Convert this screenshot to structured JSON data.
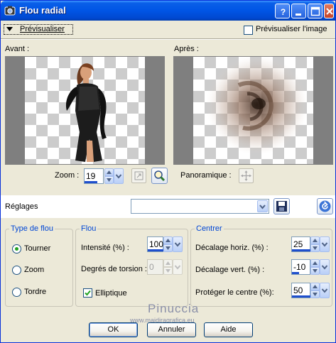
{
  "window": {
    "title": "Flou radial"
  },
  "toolbar": {
    "preview_toggle_label": "Prévisualiser",
    "preview_on_image_label": "Prévisualiser l'image"
  },
  "previews": {
    "before_label": "Avant :",
    "after_label": "Après :"
  },
  "zoom": {
    "label": "Zoom :",
    "value": "19",
    "pan_label": "Panoramique :"
  },
  "presets": {
    "label": "Réglages",
    "value": ""
  },
  "blur_type": {
    "title": "Type de flou",
    "options": [
      "Tourner",
      "Zoom",
      "Tordre"
    ],
    "selected": "Tourner"
  },
  "blur": {
    "title": "Flou",
    "intensity_label": "Intensité (%) :",
    "intensity_value": "100",
    "twist_label": "Degrés de torsion :",
    "twist_value": "0",
    "elliptic_label": "Elliptique",
    "elliptic_checked": true
  },
  "center": {
    "title": "Centrer",
    "h_offset_label": "Décalage horiz. (%) :",
    "h_offset_value": "25",
    "v_offset_label": "Décalage vert. (%) :",
    "v_offset_value": "-10",
    "protect_label": "Protéger le centre (%):",
    "protect_value": "50"
  },
  "watermark": {
    "name": "Pinuccia",
    "url": "www.maidiragrafica.eu"
  },
  "buttons": {
    "ok": "OK",
    "cancel": "Annuler",
    "help": "Aide"
  },
  "colors": {
    "title_bar": "#0055E5",
    "dialog_bg": "#ECE9D8",
    "group_title": "#0046D5",
    "checkbox_mark": "#21A121"
  },
  "icons": [
    "app-icon",
    "help-icon",
    "minimize-icon",
    "maximize-icon",
    "close-icon",
    "zoom-to-fit-icon",
    "zoom-magnifier-icon",
    "pan-icon",
    "save-preset-icon",
    "reset-icon"
  ]
}
